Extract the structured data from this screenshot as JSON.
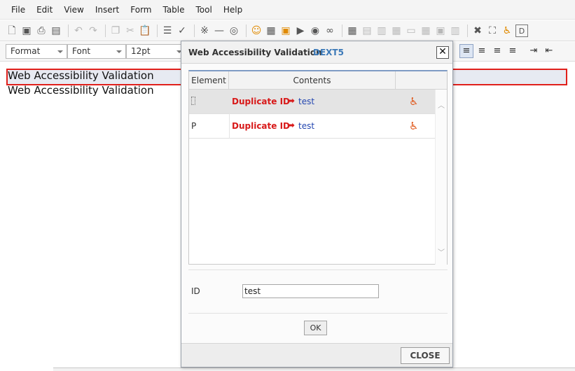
{
  "menu": {
    "items": [
      "File",
      "Edit",
      "View",
      "Insert",
      "Form",
      "Table",
      "Tool",
      "Help"
    ]
  },
  "toolbar": {
    "icons": [
      "new-document",
      "save",
      "print",
      "print-preview",
      "undo",
      "redo",
      "copy",
      "cut",
      "paste",
      "source-view",
      "spell-check",
      "special-chars",
      "horizontal-rule",
      "layer",
      "emoticon",
      "background",
      "image",
      "media",
      "flash",
      "link",
      "table",
      "table-tools",
      "find-replace",
      "fullscreen",
      "accessibility",
      "dext5-logo"
    ]
  },
  "format_bar": {
    "format_select": "Format",
    "font_select": "Font",
    "size_select": "12pt"
  },
  "editor": {
    "lines": [
      "Web Accessibility Validation",
      "Web Accessibility Validation"
    ]
  },
  "dialog": {
    "title": "Web Accessibility Validation",
    "brand": "DEXT5",
    "close_glyph": "✕",
    "table": {
      "headers": [
        "Element",
        "Contents",
        ""
      ],
      "rows": [
        {
          "element": "",
          "message": "Duplicate ID",
          "value": "test",
          "selected": true
        },
        {
          "element": "P",
          "message": "Duplicate ID",
          "value": "test",
          "selected": false
        }
      ]
    },
    "id_label": "ID",
    "id_value": "test",
    "ok_label": "OK",
    "close_label": "CLOSE"
  },
  "colors": {
    "highlight_border": "#e0201b",
    "error_text": "#d81a1a",
    "value_text": "#2346b0",
    "brand": "#3b79b8"
  }
}
